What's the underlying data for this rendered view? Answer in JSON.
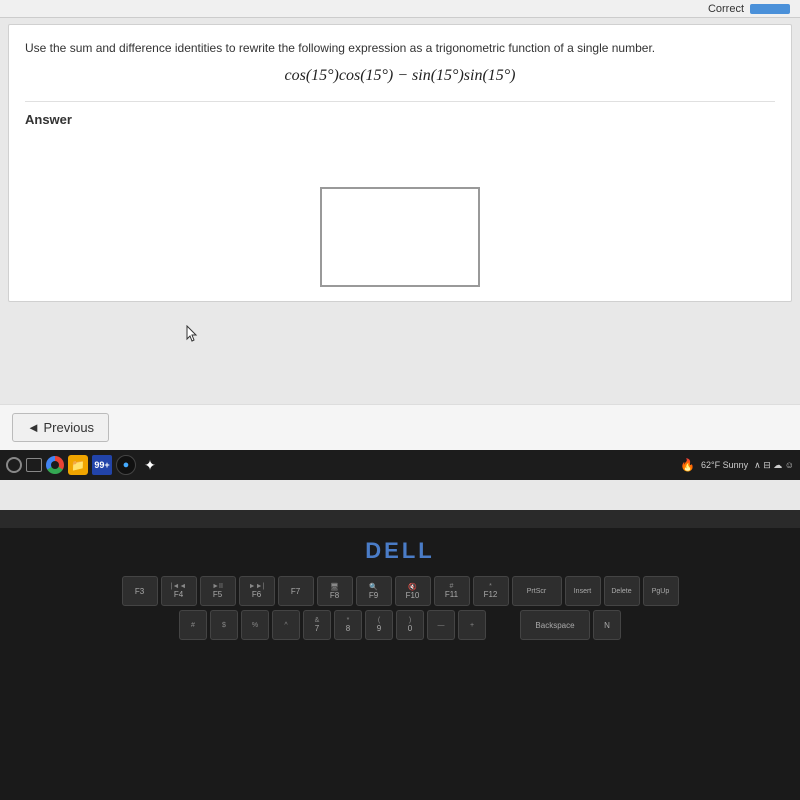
{
  "header": {
    "correct_label": "Correct",
    "bar_color": "#4a90d9"
  },
  "question": {
    "instruction": "Use the sum and difference identities to rewrite the following expression as a trigonometric function of a single number.",
    "expression": "cos(15°)cos(15°) − sin(15°)sin(15°)"
  },
  "answer_section": {
    "label": "Answer"
  },
  "navigation": {
    "prev_button": "◄ Previous"
  },
  "taskbar": {
    "weather": "62°F Sunny"
  },
  "dell_logo": "DELL",
  "keyboard": {
    "row1": [
      "F3",
      "F4",
      "F5",
      "F6",
      "F7",
      "F8",
      "F9",
      "F10",
      "F11",
      "F12",
      "PrtScr",
      "Insert",
      "Delete",
      "PgUp"
    ],
    "row2": [
      "#",
      "$",
      "%",
      "^",
      "&",
      "*",
      "(",
      ")",
      " — ",
      "+",
      " ",
      "Backspace",
      "N"
    ]
  }
}
